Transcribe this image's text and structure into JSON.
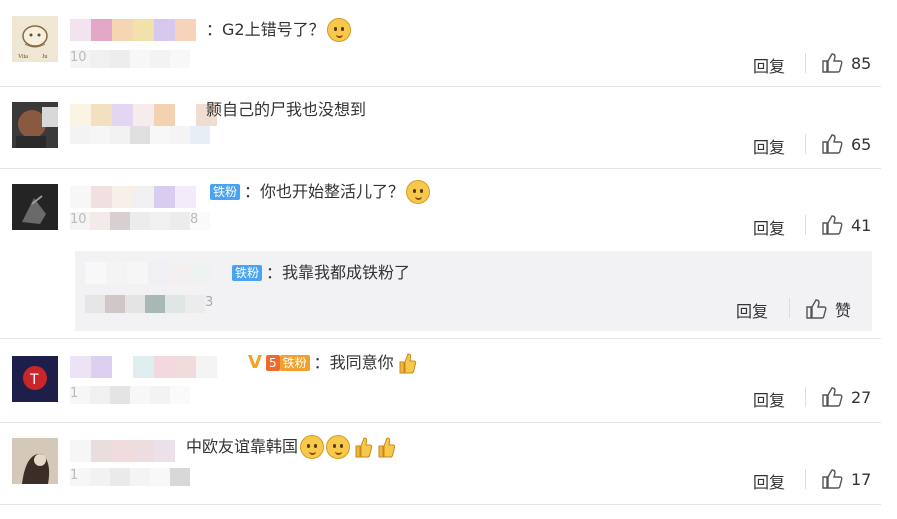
{
  "comments": [
    {
      "text": "：G2上错号了？",
      "reply": "回复",
      "likes": "85"
    },
    {
      "text": "颢自己的尸我也没想到",
      "reply": "回复",
      "likes": "65"
    },
    {
      "text": "：你也开始整活儿了？",
      "badge": "铁粉",
      "reply": "回复",
      "likes": "41"
    },
    {
      "text": "：我同意你",
      "badge": "铁粉",
      "badge_level": "5",
      "verified": "V",
      "reply": "回复",
      "likes": "27"
    },
    {
      "text": "中欧友谊靠韩国",
      "reply": "回复",
      "likes": "17"
    }
  ],
  "subreply": {
    "text": "：我靠我都成铁粉了",
    "badge": "铁粉",
    "partial_date": "3",
    "reply": "回复",
    "like_label": "赞"
  },
  "partial_dates": {
    "c1": "10",
    "c3a": "10",
    "c3b": "8",
    "c4": "1",
    "c5": "1"
  },
  "avatar_text": {
    "line1": "Vita",
    "line2": "Ju"
  },
  "colors": {
    "badge": "#4aa3f0",
    "vip": "#f7a21e",
    "divider": "#e6e6e6",
    "subbg": "#f2f2f5"
  }
}
